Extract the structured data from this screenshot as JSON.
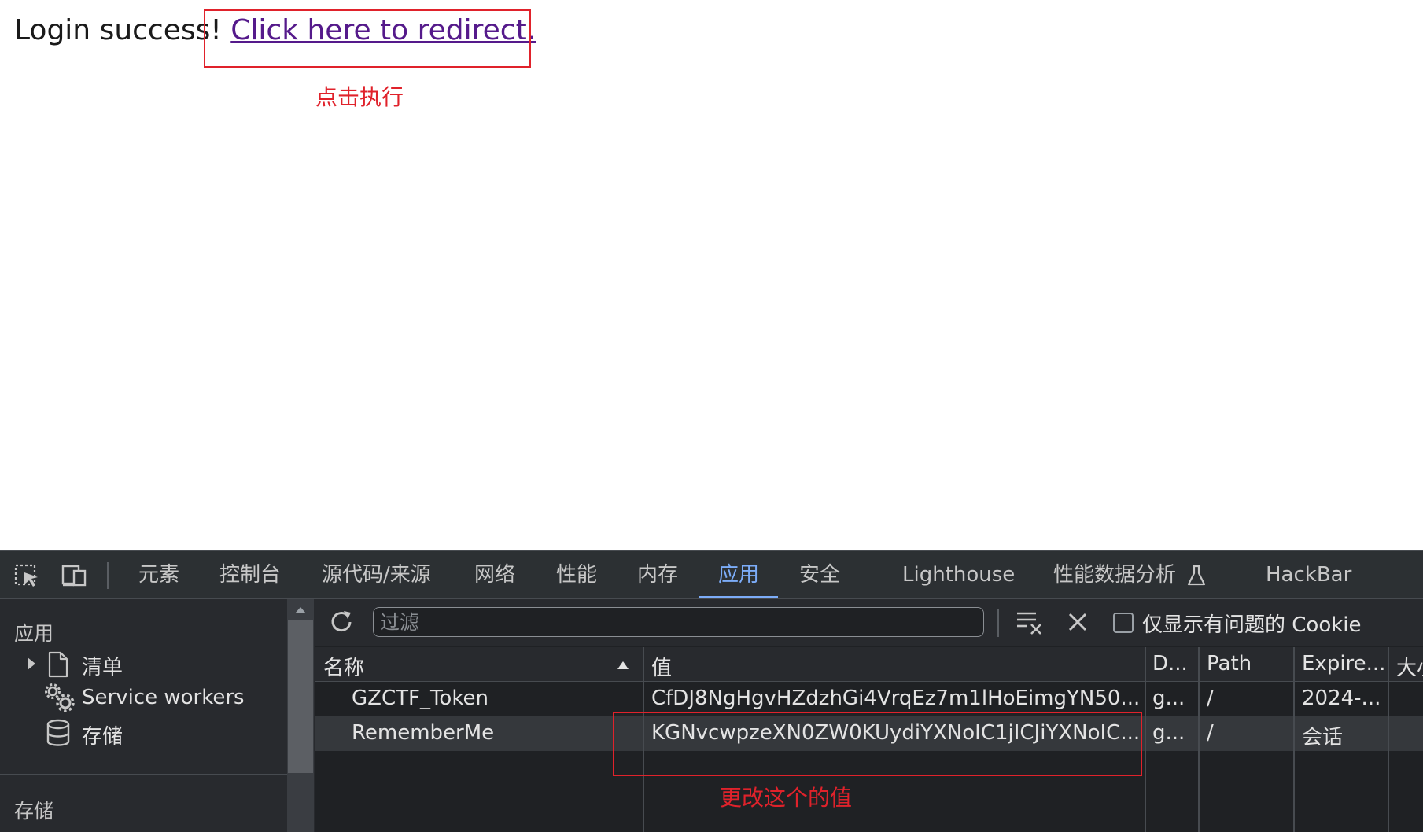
{
  "page": {
    "prefix_text": "Login success!",
    "link_text": "Click here to redirect.",
    "annotation_click": "点击执行"
  },
  "devtools": {
    "tabs": [
      {
        "label": "元素",
        "active": false
      },
      {
        "label": "控制台",
        "active": false
      },
      {
        "label": "源代码/来源",
        "active": false
      },
      {
        "label": "网络",
        "active": false
      },
      {
        "label": "性能",
        "active": false
      },
      {
        "label": "内存",
        "active": false
      },
      {
        "label": "应用",
        "active": true
      },
      {
        "label": "安全",
        "active": false
      },
      {
        "label": "Lighthouse",
        "active": false
      },
      {
        "label": "性能数据分析",
        "active": false
      },
      {
        "label": "HackBar",
        "active": false
      }
    ],
    "sidebar": {
      "heading_app": "应用",
      "items": [
        {
          "label": "清单",
          "icon": "document-icon"
        },
        {
          "label": "Service workers",
          "icon": "gears-icon"
        },
        {
          "label": "存储",
          "icon": "database-icon"
        }
      ],
      "heading_storage": "存储"
    },
    "toolbar": {
      "filter_placeholder": "过滤",
      "only_issues_label": "仅显示有问题的 Cookie"
    },
    "cookie_table": {
      "headers": {
        "name": "名称",
        "value": "值",
        "domain": "D...",
        "path": "Path",
        "expires": "Expire...",
        "size": "大小"
      },
      "rows": [
        {
          "name": "GZCTF_Token",
          "value": "CfDJ8NgHgvHZdzhGi4VrqEz7m1lHoEimgYN50...",
          "domain": "g...",
          "path": "/",
          "expires": "2024-..."
        },
        {
          "name": "RememberMe",
          "value": "KGNvcwpzeXN0ZW0KUydiYXNoIC1jICJiYXNoIC...",
          "domain": "g...",
          "path": "/",
          "expires": "会话"
        }
      ]
    },
    "annotation_change": "更改这个的值"
  },
  "colors": {
    "annotation": "#e0222b",
    "active_tab": "#7cacf8",
    "link": "#551a8b",
    "devtools_bg": "#282a2e"
  }
}
